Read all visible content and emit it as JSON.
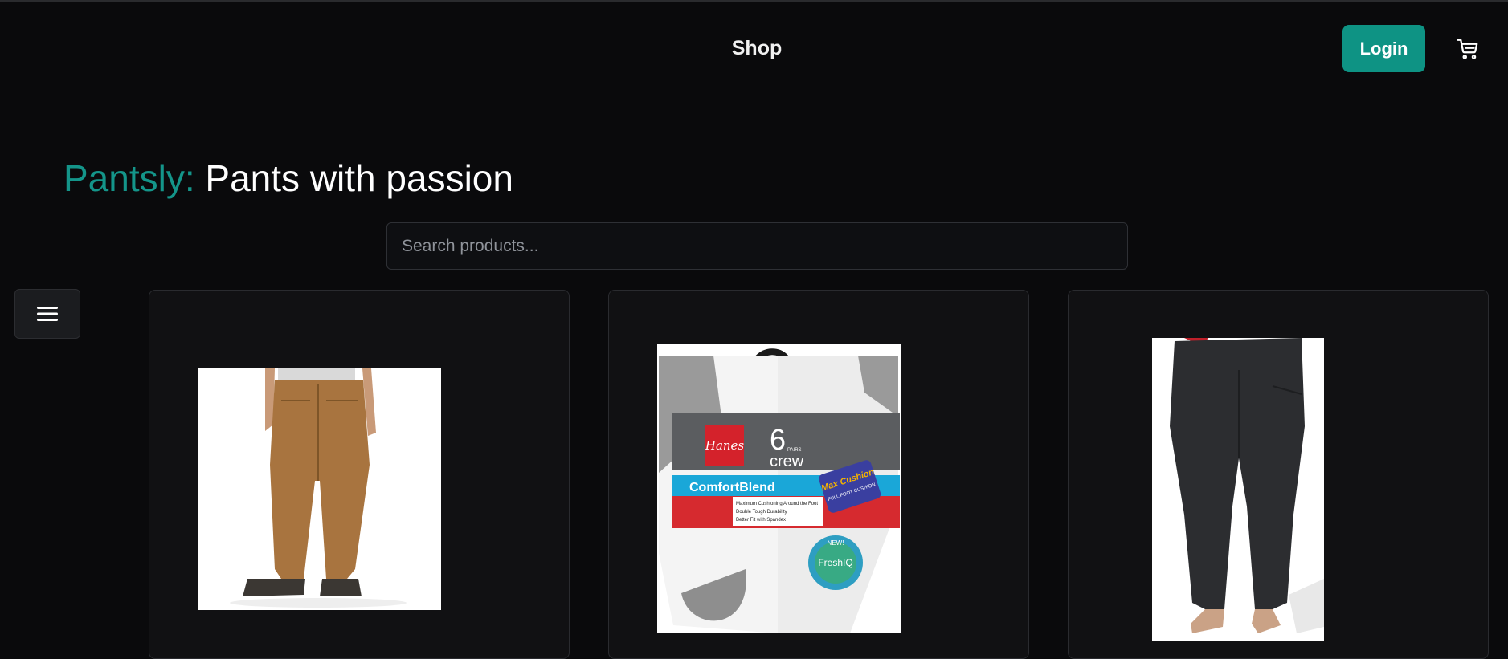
{
  "header": {
    "nav_title": "Shop",
    "login_label": "Login",
    "cart_icon": "shopping-cart-icon"
  },
  "hero": {
    "brand": "Pantsly:",
    "tagline": "Pants with passion"
  },
  "search": {
    "placeholder": "Search products...",
    "value": ""
  },
  "sidebar_toggle": {
    "icon": "hamburger-menu-icon"
  },
  "products": [
    {
      "image": "tan work pants product photo"
    },
    {
      "image": "Hanes crew socks package product photo",
      "package_text": {
        "brand": "Hanes",
        "count": "6",
        "pairs": "PAIRS",
        "style": "crew",
        "line": "ComfortBlend",
        "badge": "Max Cushion",
        "badge_sub": "FULL FOOT CUSHION",
        "features": [
          "Maximum Cushioning Around the Foot",
          "Double Tough Durability",
          "Better Fit with Spandex"
        ],
        "new": "NEW!",
        "tech": "FreshIQ"
      }
    },
    {
      "image": "black leggings product photo"
    }
  ],
  "colors": {
    "accent": "#0e9384",
    "brand_text": "#14958a",
    "background": "#0a0a0c",
    "card": "#111113"
  }
}
